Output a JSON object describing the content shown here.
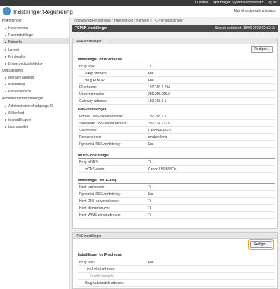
{
  "topbar": {
    "portal_link": "Til portal",
    "login_user": "Login-bruger: Systemadministrator",
    "logout": "Log ud"
  },
  "header": {
    "title": "Indstillinger/Registrering",
    "mail_link": "Mail til systemadministrator"
  },
  "sidebar": {
    "preferences_label": "Præferencer",
    "preferences_items": [
      {
        "label": "Kontrolmenu"
      },
      {
        "label": "Papirindstillinger"
      },
      {
        "label": "Netværk"
      },
      {
        "label": "Layout"
      },
      {
        "label": "Printkvalitet"
      },
      {
        "label": "Brugervedligeholdelse"
      }
    ],
    "output_label": "Outputkontrol",
    "output_items": [
      {
        "label": "Menuen Værktøj"
      },
      {
        "label": "Kalibrering"
      },
      {
        "label": "Enhedskontrol"
      }
    ],
    "admin_label": "Administrationsindstillinger",
    "admin_items": [
      {
        "label": "Administration af adgangs-ID"
      },
      {
        "label": "Sikkerhed"
      },
      {
        "label": "Import/Eksport"
      },
      {
        "label": "Licens/andet"
      }
    ]
  },
  "main": {
    "breadcrumb": "Indstillinger/Registrering : Præferencer : Netværk > TCP/IP-indstillinger",
    "title": "TCP/IP-indstillinger",
    "last_updated": "Senest opdateret: 18/06 2019 02:52:15",
    "ipv4_panel_title": "IPv4-indstillinger",
    "edit_label": "Rediger...",
    "ipv6_panel_title": "IPv6-indstillinger",
    "sections": [
      {
        "title": "Indstillinger for IP-adresse",
        "rows": [
          {
            "label": "Brug IPv4:",
            "value": "Til",
            "indent": 0
          },
          {
            "label": "Vælg protokol:",
            "value": "Fra",
            "indent": 1
          },
          {
            "label": "Brug Auto IP:",
            "value": "Fra",
            "indent": 1
          },
          {
            "label": "IP-adresse:",
            "value": "192.168.1.234",
            "indent": 0
          },
          {
            "label": "Undernetmaske:",
            "value": "255.255.255.0",
            "indent": 0
          },
          {
            "label": "Gateway-adresse:",
            "value": "192.168.1.1",
            "indent": 0
          }
        ]
      },
      {
        "title": "DNS-indstillinger",
        "rows": [
          {
            "label": "Primær DNS-serveradresse:",
            "value": "192.168.1.5",
            "indent": 0
          },
          {
            "label": "Sekundær DNS-serveradresse:",
            "value": "202.234.232.6",
            "indent": 0
          },
          {
            "label": "Værtsnavn:",
            "value": "CanonFFA3F9",
            "indent": 0
          },
          {
            "label": "Domænenavn:",
            "value": "modem.local",
            "indent": 0
          },
          {
            "label": "Dynamisk DNS-opdatering:",
            "value": "Fra",
            "indent": 0
          }
        ]
      },
      {
        "title": "mDNS-indstillinger",
        "rows": [
          {
            "label": "Brug mDNS:",
            "value": "Til",
            "indent": 0
          },
          {
            "label": "mDNS-navn:",
            "value": "Canon LBP653Cx",
            "indent": 1
          }
        ]
      },
      {
        "title": "Indstillinger DHCP-valg",
        "rows": [
          {
            "label": "Hent værtsnavn:",
            "value": "Til",
            "indent": 0
          },
          {
            "label": "Dynamisk DNS-opdatering:",
            "value": "Fra",
            "indent": 0
          },
          {
            "label": "Hent DNS-serveradresse:",
            "value": "Til",
            "indent": 0
          },
          {
            "label": "Hent domænenavn:",
            "value": "Til",
            "indent": 0
          },
          {
            "label": "Hent WINS-serveradresse:",
            "value": "Til",
            "indent": 0
          }
        ]
      }
    ],
    "ipv6_section": {
      "title": "Indstillinger for IP-adresse",
      "rows": [
        {
          "label": "Brug IPv6:",
          "value": "Fra",
          "indent": 0
        },
        {
          "label": "Link-Lokal-adresse:",
          "value": "",
          "indent": 1
        },
        {
          "label": "Præfikslængde",
          "value": "",
          "indent": 2
        },
        {
          "label": "Brug Automatisk adresse:",
          "value": "",
          "indent": 1
        }
      ]
    }
  }
}
